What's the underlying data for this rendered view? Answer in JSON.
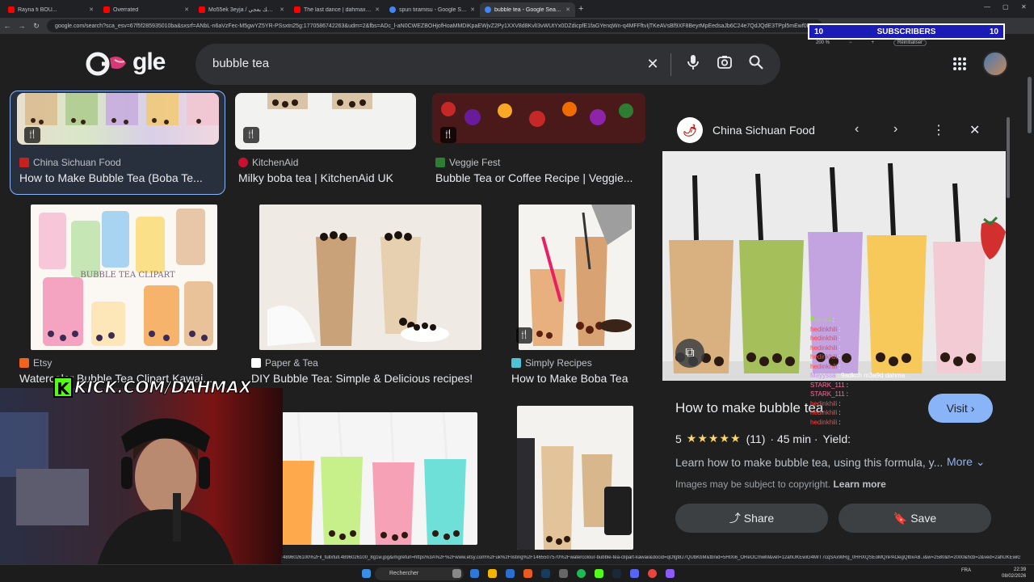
{
  "browser": {
    "tabs": [
      {
        "label": "Rayna fi BOU...",
        "color": "#ff0000"
      },
      {
        "label": "Overrated",
        "color": "#ff0000"
      },
      {
        "label": "Mo55ek 3eyja / مسك بعجي - You",
        "color": "#ff0000"
      },
      {
        "label": "The last dance | dahmax, Loujeh",
        "color": "#ff0000"
      },
      {
        "label": "spun tiramisu - Google Search",
        "color": "#4285f4"
      },
      {
        "label": "bubble tea - Google Search",
        "color": "#4285f4"
      }
    ],
    "active_tab_index": 5,
    "url": "google.com/search?sca_esv=67f5f285935010ba&sxsrf=ANbL-n6aVzFec-M5gwYZ5YR-PSsxtn25g:1770586742263&udm=2&fbs=ADc_l-aN0CWEZBOHjofHoaMMDiKpaEWjvZ2Py1XXV8d8KvlI3vWUtYx0DZdicpfE1faGYenqWn-q4MFFftvIjTKeAVsBf9XF8BeyrMpEedsaJb6C24e7QdJQdE3TPpl5mEwf0EBCRL"
  },
  "overlay": {
    "subs_left": "10",
    "subs_label": "SUBSCRIBERS",
    "subs_right": "10",
    "zoom_level": "200 %",
    "zoom_minus": "−",
    "zoom_plus": "+",
    "zoom_reset": "Réinitialiser",
    "kick_text": "KICK.COM/DAHMAX"
  },
  "google": {
    "logo": "Google",
    "query": "bubble tea"
  },
  "results": [
    {
      "source": "China Sichuan Food",
      "title": "How to Make Bubble Tea (Boba Te...",
      "source_color": "#c5221f"
    },
    {
      "source": "KitchenAid",
      "title": "Milky boba tea | KitchenAid UK",
      "source_color": "#c41230"
    },
    {
      "source": "Veggie Fest",
      "title": "Bubble Tea or Coffee Recipe | Veggie...",
      "source_color": "#2e7d32"
    },
    {
      "source": "Etsy",
      "title": "Watercolor Bubble Tea Clipart Kawai...",
      "source_color": "#f1641e"
    },
    {
      "source": "Paper & Tea",
      "title": "DIY Bubble Tea: Simple & Delicious recipes!",
      "source_color": "#ffffff"
    },
    {
      "source": "Simply Recipes",
      "title": "How to Make Boba Tea",
      "source_color": "#4ec3d6"
    }
  ],
  "clipart_text": "BUBBLE TEA CLIPART",
  "panel": {
    "source": "China Sichuan Food",
    "title": "How to make bubble tea",
    "visit": "Visit",
    "rating_value": "5",
    "stars": "★★★★★",
    "reviews": "(11)",
    "time": "· 45 min ·",
    "yield": "Yield:",
    "description": "Learn how to make bubble tea, using this formula, y...",
    "more": "More",
    "copyright": "Images may be subject to copyright.",
    "learn_more": "Learn more",
    "share": "Share",
    "save": "Save"
  },
  "chat": [
    {
      "user": "Boliulul",
      "msg": ":",
      "cls": "u1"
    },
    {
      "user": "hedinkhili",
      "msg": ":",
      "cls": "u2"
    },
    {
      "user": "hedinkhili",
      "msg": ":",
      "cls": "u2"
    },
    {
      "user": "hedinkhili",
      "msg": ":",
      "cls": "u2"
    },
    {
      "user": "hedinkhili",
      "msg": ":",
      "cls": "u2"
    },
    {
      "user": "hedinkhili",
      "msg": ":",
      "cls": "u2"
    },
    {
      "user": "Mayyssa",
      "msg": ": 9adkch m3a9d dahma",
      "cls": "u3"
    },
    {
      "user": "STARK_111",
      "msg": ":",
      "cls": "u4"
    },
    {
      "user": "STARK_111",
      "msg": ":",
      "cls": "u4"
    },
    {
      "user": "hedinkhili",
      "msg": ":",
      "cls": "u2"
    },
    {
      "user": "hedinkhili",
      "msg": ":",
      "cls": "u2"
    },
    {
      "user": "hedinkhili",
      "msg": ":",
      "cls": "u2"
    }
  ],
  "statusbar_url": "4896026100%2Fil_fullxfull.4896026100_8g1w.jpg&imgrefurl=https%3A%2F%2Fwww.etsy.com%2Fuk%2Flisting%2F1465507570%2Fwatercolour-bubble-tea-clipart-kawaii&docid=qOfgt8J7QUbKbM&tbnid=5HIXi6_OReOCmwM&vet=12ahUKEwiG4MrT7cqSAxWRg_0HHXQSEoMQnPAOegQIbxAB..i&w=2580&h=2000&hcb=2&ved=2ahUKEwiG4MrT7",
  "taskbar": {
    "search": "Rechercher",
    "lang": "FRA",
    "time": "22:39",
    "date": "08/02/2026"
  }
}
